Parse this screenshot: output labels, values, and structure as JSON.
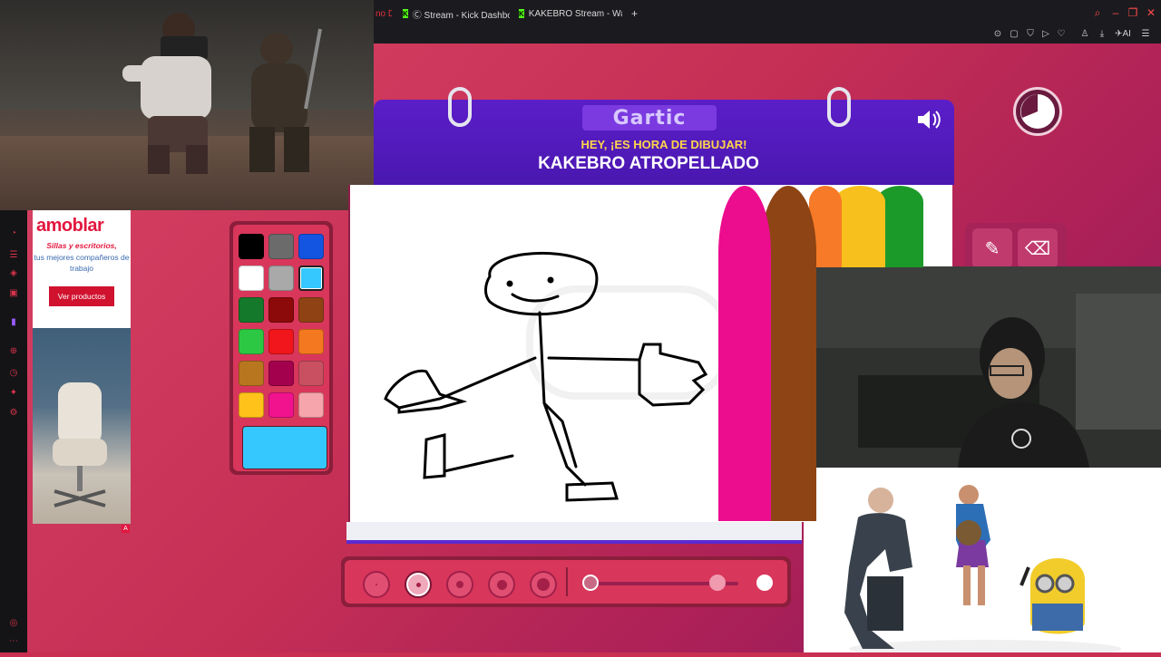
{
  "browser": {
    "tabs": [
      {
        "label": "no D"
      },
      {
        "label": "Ⓒ Stream - Kick Dashbo"
      },
      {
        "label": "KAKEBRO Stream - Watch"
      }
    ],
    "new_tab": "+"
  },
  "ad": {
    "brand": "amoblar",
    "tagline": "Sillas y escritorios,",
    "subline": "tus mejores compañeros de trabajo",
    "cta": "Ver productos",
    "badge": "A"
  },
  "game": {
    "logo": "Gartic",
    "hint": "HEY, ¡ES HORA DE DIBUJAR!",
    "word": "KAKEBRO ATROPELLADO",
    "palette": [
      "#000000",
      "#6b6b6b",
      "#1354e0",
      "#ffffff",
      "#a9a9a9",
      "#35c8ff",
      "#15792b",
      "#8c0a0a",
      "#8f4314",
      "#2dc843",
      "#f0161b",
      "#f4781f",
      "#b8761e",
      "#a3014d",
      "#c95060",
      "#ffc21a",
      "#f1138e",
      "#f5a5ab"
    ],
    "selected_color": "#35c8ff",
    "marker_colors": [
      "#ec0c8e",
      "#8e4414",
      "#f67a28",
      "#f7c01d",
      "#1b9a2a"
    ],
    "brush_size_selected_index": 1,
    "opacity_level": 0.85,
    "colors": {
      "header": "#5b1ec8",
      "accent": "#ffd54a",
      "background": "#c82f51"
    }
  },
  "icons": {
    "sound": "speaker-icon",
    "timer": "timer-icon",
    "pencil": "pencil-icon",
    "eraser": "eraser-icon"
  }
}
